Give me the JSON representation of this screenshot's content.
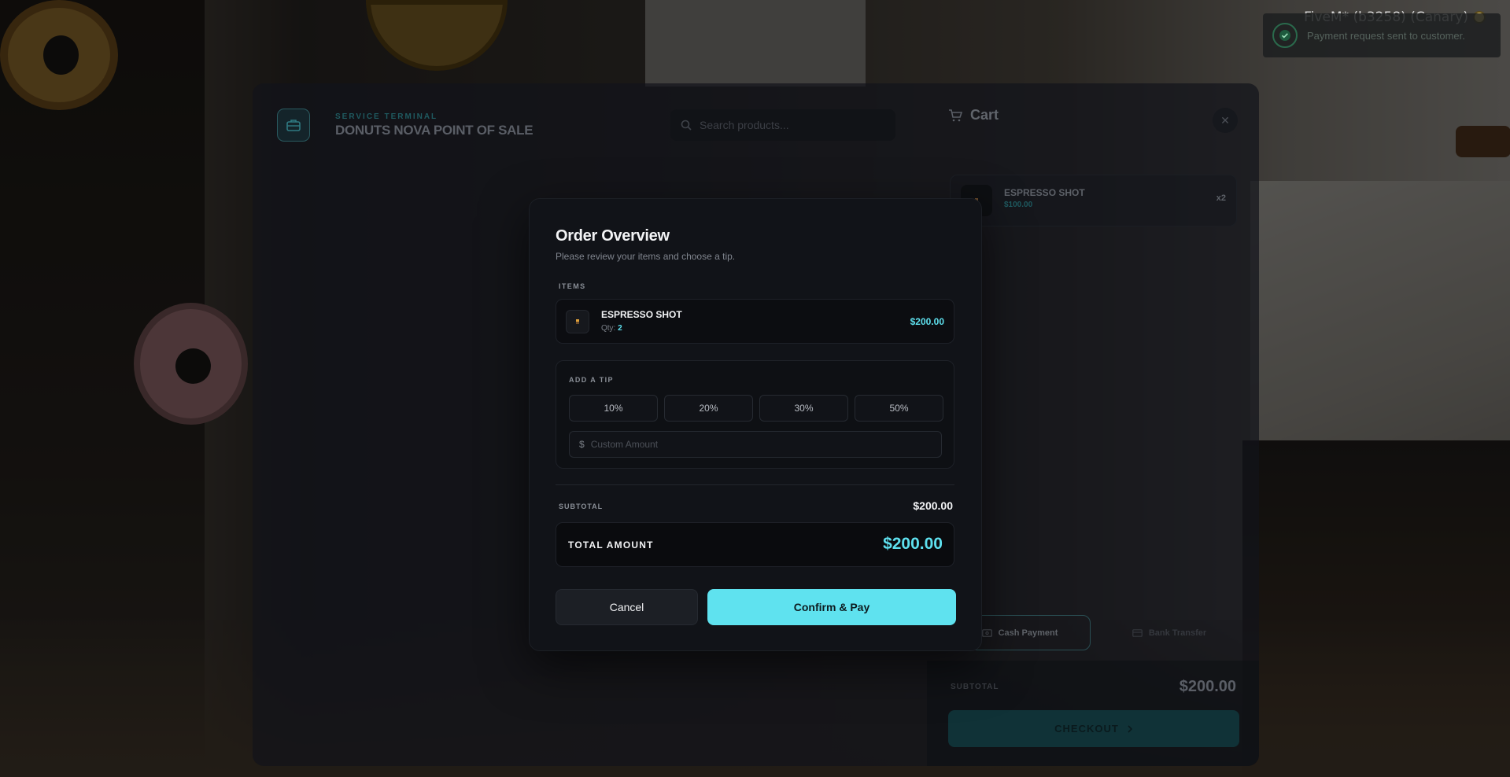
{
  "overlay": {
    "client_tag": "FiveM* (b3258) (Canary)",
    "notification": {
      "text": "Payment request sent to customer.",
      "icon": "check-circle-icon"
    }
  },
  "pos": {
    "subtitle": "SERVICE TERMINAL",
    "title": "DONUTS NOVA POINT OF SALE",
    "search_placeholder": "Search products...",
    "cart": {
      "title": "Cart",
      "items": [
        {
          "name": "ESPRESSO SHOT",
          "price": "$100.00",
          "qty": "x2"
        }
      ]
    },
    "payment_methods": [
      "Cash Payment",
      "Bank Transfer"
    ],
    "subtotal_label": "SUBTOTAL",
    "subtotal_value": "$200.00",
    "checkout_label": "CHECKOUT"
  },
  "modal": {
    "title": "Order Overview",
    "description": "Please review your items and choose a tip.",
    "items_label": "ITEMS",
    "items": [
      {
        "name": "ESPRESSO SHOT",
        "qty_label": "Qty:",
        "qty": "2",
        "price": "$200.00"
      }
    ],
    "tip": {
      "label": "ADD A TIP",
      "options": [
        "10%",
        "20%",
        "30%",
        "50%"
      ],
      "currency_symbol": "$",
      "custom_placeholder": "Custom Amount",
      "custom_value": ""
    },
    "subtotal_label": "SUBTOTAL",
    "subtotal_value": "$200.00",
    "total_label": "TOTAL AMOUNT",
    "total_value": "$200.00",
    "cancel_label": "Cancel",
    "confirm_label": "Confirm & Pay"
  },
  "colors": {
    "accent": "#5fe2ef",
    "modal_bg": "#111318",
    "success": "#2a6a4c"
  }
}
